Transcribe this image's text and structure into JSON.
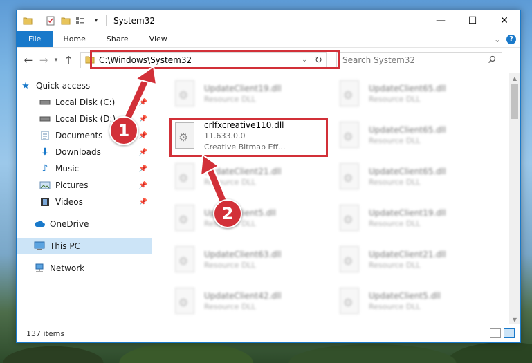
{
  "window": {
    "title": "System32",
    "minimize": "—",
    "maximize": "☐",
    "close": "✕"
  },
  "ribbon": {
    "tabs": [
      "File",
      "Home",
      "Share",
      "View"
    ],
    "collapse": "⌄",
    "help": "?"
  },
  "address": {
    "path": "C:\\Windows\\System32",
    "dropdown": "⌄",
    "refresh": "↻"
  },
  "search": {
    "placeholder": "Search System32",
    "icon": "search-icon"
  },
  "nav": {
    "quick_access": "Quick access",
    "local_c": "Local Disk (C:)",
    "local_d": "Local Disk (D:)",
    "documents": "Documents",
    "downloads": "Downloads",
    "music": "Music",
    "pictures": "Pictures",
    "videos": "Videos",
    "onedrive": "OneDrive",
    "this_pc": "This PC",
    "network": "Network"
  },
  "files": {
    "highlighted": {
      "name": "crlfxcreative110.dll",
      "version": "11.633.0.0",
      "description": "Creative Bitmap Eff..."
    },
    "left": [
      {
        "name": "UpdateClient19.dll",
        "sub": "Resource DLL"
      },
      {
        "name": "UpdateClient21.dll",
        "sub": "Resource DLL"
      },
      {
        "name": "UpdateClient5.dll",
        "sub": "Resource DLL"
      },
      {
        "name": "UpdateClient63.dll",
        "sub": "Resource DLL"
      },
      {
        "name": "UpdateClient42.dll",
        "sub": "Resource DLL"
      }
    ],
    "right": [
      {
        "name": "UpdateClient65.dll",
        "sub": "Resource DLL"
      },
      {
        "name": "UpdateClient65.dll",
        "sub": "Resource DLL"
      },
      {
        "name": "UpdateClient65.dll",
        "sub": "Resource DLL"
      },
      {
        "name": "UpdateClient19.dll",
        "sub": "Resource DLL"
      },
      {
        "name": "UpdateClient21.dll",
        "sub": "Resource DLL"
      },
      {
        "name": "UpdateClient5.dll",
        "sub": "Resource DLL"
      }
    ]
  },
  "status": {
    "count": "137 items"
  },
  "callouts": {
    "one": "1",
    "two": "2"
  },
  "colors": {
    "accent": "#1979ca",
    "highlight": "#d23038"
  }
}
